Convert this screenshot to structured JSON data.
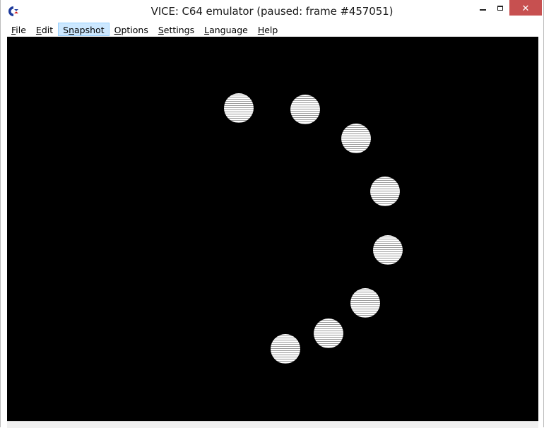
{
  "window": {
    "title": "VICE: C64 emulator (paused: frame #457051)",
    "icon": "commodore-logo-icon"
  },
  "controls": {
    "minimize": "minimize-icon",
    "maximize": "maximize-icon",
    "close": "close-icon",
    "close_glyph": "✕"
  },
  "menu": {
    "items": [
      "File",
      "Edit",
      "Snapshot",
      "Options",
      "Settings",
      "Language",
      "Help"
    ],
    "underline_index": [
      0,
      0,
      1,
      0,
      0,
      0,
      0
    ],
    "active": "Snapshot",
    "highlight_color": "#cce8ff"
  },
  "screen": {
    "background": "#000000",
    "balls": 8,
    "ball_color": "#ffffff"
  }
}
